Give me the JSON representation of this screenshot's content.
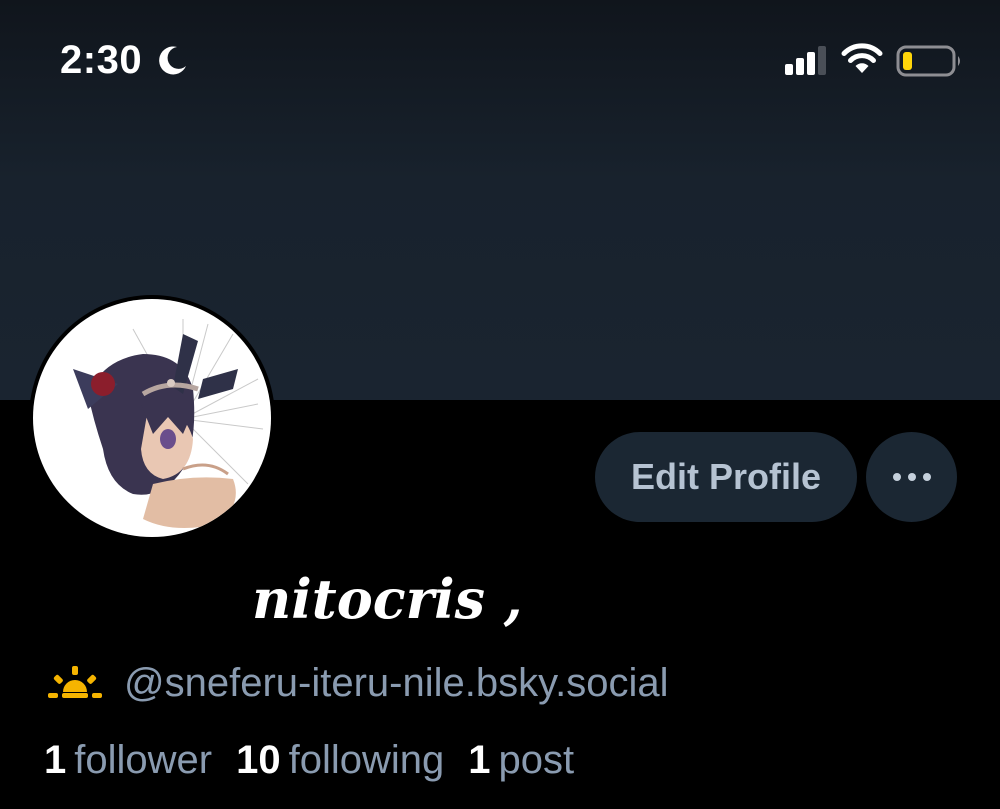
{
  "status_bar": {
    "time": "2:30",
    "focus_icon": "moon-icon",
    "signal_icon": "cellular-signal-icon",
    "wifi_icon": "wifi-icon",
    "battery_icon": "battery-icon",
    "battery_level": 0.2,
    "battery_color": "#ffd60a"
  },
  "profile": {
    "avatar_icon": "avatar-image",
    "display_name": "nitocris ,",
    "handle_emoji_icon": "sunrise-icon",
    "handle": "@sneferu-iteru-nile.bsky.social",
    "buttons": {
      "edit_profile": "Edit Profile",
      "more_icon": "ellipsis-icon"
    },
    "stats": {
      "followers_count": "1",
      "followers_label": "follower",
      "following_count": "10",
      "following_label": "following",
      "posts_count": "1",
      "posts_label": "post"
    }
  },
  "colors": {
    "banner": "#1a2430",
    "background": "#000000",
    "button_bg": "#1b2733",
    "button_text": "#b6c3d2",
    "secondary_text": "#8a9bb0",
    "primary_text": "#ffffff",
    "sunrise_icon": "#f5b400"
  }
}
